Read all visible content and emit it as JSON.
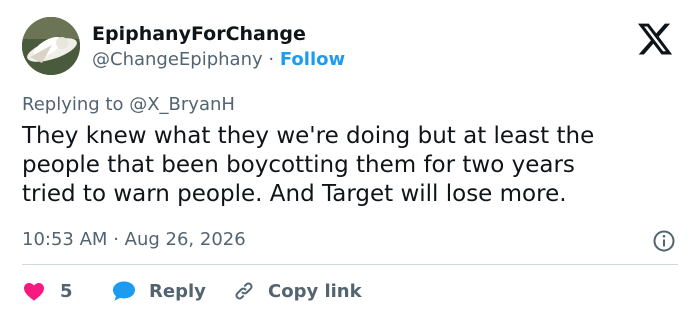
{
  "author": {
    "display_name": "EpiphanyForChange",
    "handle": "@ChangeEpiphany",
    "separator": "·",
    "follow_label": "Follow"
  },
  "tweet": {
    "replying_prefix": "Replying to",
    "replying_to": "@X_BryanH",
    "text_lines": [
      "They knew what they we're doing but at least the",
      "people that been boycotting them for two years",
      "tried to warn people. And Target will lose more."
    ],
    "time": "10:53 AM",
    "meta_separator": "·",
    "date": "Aug 26, 2026"
  },
  "actions": {
    "like_count": "5",
    "reply_label": "Reply",
    "copy_label": "Copy link"
  },
  "colors": {
    "like": "#f91880",
    "reply": "#1d9bf0",
    "follow": "#1d9bf0",
    "secondary_text": "#536471",
    "divider": "#cfd9de"
  },
  "icons": {
    "brand": "x-logo-icon",
    "info": "info-icon",
    "like": "heart-icon",
    "reply": "speech-bubble-icon",
    "copy": "link-icon"
  }
}
